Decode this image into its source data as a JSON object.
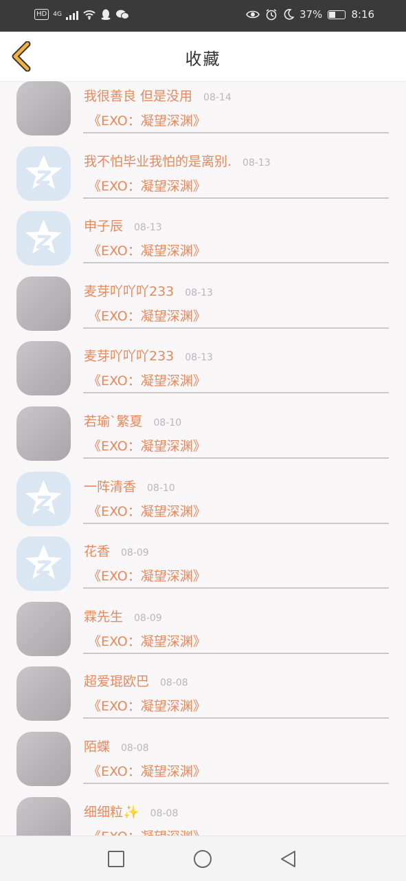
{
  "status_bar": {
    "network_label": "HD",
    "network_type": "4G",
    "battery_percent": "37%",
    "time": "8:16",
    "left_icons": [
      "signal-icon",
      "wifi-icon",
      "qq-icon",
      "wechat-icon"
    ],
    "right_icons": [
      "eye-icon",
      "alarm-icon",
      "moon-icon",
      "battery-icon"
    ]
  },
  "header": {
    "title": "收藏",
    "back_icon": "chevron-left-icon",
    "accent_color": "#f2b33d"
  },
  "colors": {
    "name": "#e58a5e",
    "date": "#b7b7bb",
    "default_avatar": "#dbe6f3"
  },
  "items": [
    {
      "name": "我很善良 但是没用",
      "date": "08-14",
      "subtitle": "《EXO：凝望深渊》",
      "avatar": "photo"
    },
    {
      "name": "我不怕毕业我怕的是离别.",
      "date": "08-13",
      "subtitle": "《EXO：凝望深渊》",
      "avatar": "default"
    },
    {
      "name": "申子辰",
      "date": "08-13",
      "subtitle": "《EXO：凝望深渊》",
      "avatar": "default"
    },
    {
      "name": "麦芽吖吖吖233",
      "date": "08-13",
      "subtitle": "《EXO：凝望深渊》",
      "avatar": "photo"
    },
    {
      "name": "麦芽吖吖吖233",
      "date": "08-13",
      "subtitle": "《EXO：凝望深渊》",
      "avatar": "photo"
    },
    {
      "name": "若瑜`繁夏",
      "date": "08-10",
      "subtitle": "《EXO：凝望深渊》",
      "avatar": "photo"
    },
    {
      "name": "一阵清香",
      "date": "08-10",
      "subtitle": "《EXO：凝望深渊》",
      "avatar": "default"
    },
    {
      "name": "花香",
      "date": "08-09",
      "subtitle": "《EXO：凝望深渊》",
      "avatar": "default"
    },
    {
      "name": "霖先生",
      "date": "08-09",
      "subtitle": "《EXO：凝望深渊》",
      "avatar": "photo"
    },
    {
      "name": "超爱琨欧巴",
      "date": "08-08",
      "subtitle": "《EXO：凝望深渊》",
      "avatar": "photo"
    },
    {
      "name": "陌蝶",
      "date": "08-08",
      "subtitle": "《EXO：凝望深渊》",
      "avatar": "photo"
    },
    {
      "name": "细细粒✨",
      "date": "08-08",
      "subtitle": "《EXO：凝望深渊》",
      "avatar": "photo"
    }
  ],
  "nav_bar": {
    "buttons": [
      "recent-apps-square-icon",
      "home-circle-icon",
      "back-triangle-icon"
    ]
  }
}
